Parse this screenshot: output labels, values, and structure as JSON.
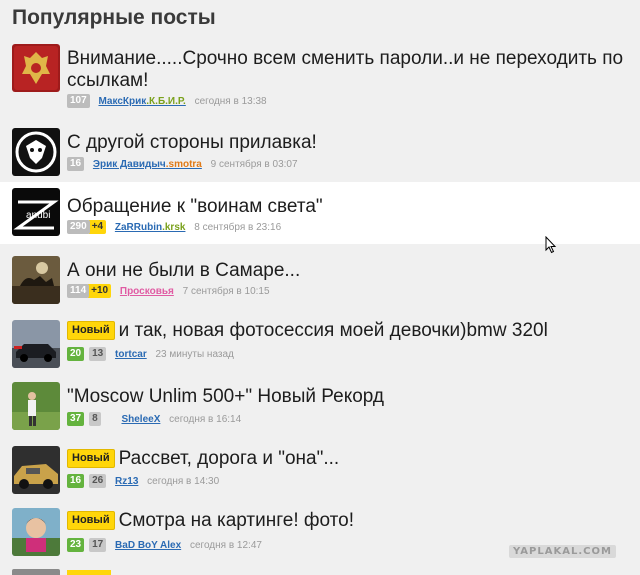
{
  "heading": "Популярные посты",
  "posts": [
    {
      "title": "Внимание.....Срочно всем сменить пароли..и не переходить по ссылкам!",
      "count": "107",
      "plus": "",
      "author": "МаксКрик",
      "author_suffix": ".К.Б.И.Р.",
      "time": "сегодня в 13:38",
      "new": ""
    },
    {
      "title": "С другой стороны прилавка!",
      "count": "16",
      "plus": "",
      "author": "Эрик Давидыч",
      "author_suffix": ".smotra",
      "time": "9 сентября в 03:07",
      "new": ""
    },
    {
      "title": "Обращение к \"воинам света\"",
      "count": "290",
      "plus": "+4",
      "author": "ZaRRubin",
      "author_suffix": ".krsk",
      "time": "8 сентября в 23:16",
      "new": "",
      "thumb_text": "anubi"
    },
    {
      "title": "А они не были в Самаре...",
      "count": "114",
      "plus": "+10",
      "author": "Просковья",
      "author_suffix": "",
      "time": "7 сентября в 10:15",
      "new": ""
    },
    {
      "title": "и так, новая фотосессия моей девочки)bmw 320l",
      "count": "20",
      "count2": "13",
      "author": "tortcar",
      "author_suffix": "",
      "time": "23 минуты назад",
      "new": "Новый"
    },
    {
      "title": "\"Moscow Unlim 500+\" Новый Рекорд",
      "count": "37",
      "count2": "8",
      "author": "SheleeX",
      "author_suffix": "",
      "time": "сегодня в 16:14",
      "new": ""
    },
    {
      "title": "Рассвет, дорога и \"она\"...",
      "count": "16",
      "count2": "26",
      "author": "Rz13",
      "author_suffix": "",
      "time": "сегодня в 14:30",
      "new": "Новый"
    },
    {
      "title": "Смотра на картинге! фото!",
      "count": "23",
      "count2": "17",
      "author": "BaD BoY Alex",
      "author_suffix": "",
      "time": "сегодня в 12:47",
      "new": "Новый"
    }
  ],
  "watermark": "YAPLAKAL.COM",
  "icons": {
    "cursor": "mouse-pointer-icon"
  }
}
